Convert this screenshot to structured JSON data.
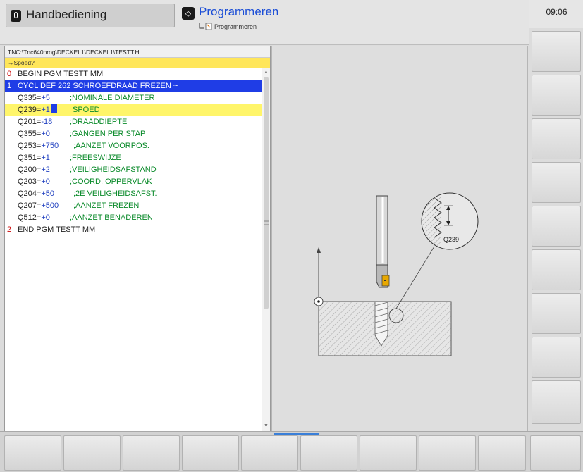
{
  "header": {
    "mode_manual": "Handbediening",
    "mode_program": "Programmeren",
    "mode_program_sub": "Programmeren",
    "clock": "09:06",
    "manual_icon": "hand-icon",
    "program_icon": "diamond-arrow-icon"
  },
  "program": {
    "path": "TNC:\\Tnc640prog\\DECKEL1\\DECKEL1\\TESTT.H",
    "question": "→Spoed?",
    "lines": [
      {
        "num": "0",
        "text": "BEGIN PGM TESTT MM"
      },
      {
        "num": "1",
        "text": "CYCL DEF 262 SCHROEFDRAAD FREZEN ~"
      },
      {
        "q": "Q335=",
        "qv": "+5",
        "comment": ";NOMINALE DIAMETER"
      },
      {
        "q": "Q239=",
        "qv": "+1",
        "comment": "SPOED"
      },
      {
        "q": "Q201=",
        "qv": "-18",
        "comment": ";DRAADDIEPTE"
      },
      {
        "q": "Q355=",
        "qv": "+0",
        "comment": ";GANGEN PER STAP"
      },
      {
        "q": "Q253=",
        "qv": "+750",
        "comment": ";AANZET VOORPOS."
      },
      {
        "q": "Q351=",
        "qv": "+1",
        "comment": ";FREESWIJZE"
      },
      {
        "q": "Q200=",
        "qv": "+2",
        "comment": ";VEILIGHEIDSAFSTAND"
      },
      {
        "q": "Q203=",
        "qv": "+0",
        "comment": ";COORD. OPPERVLAK"
      },
      {
        "q": "Q204=",
        "qv": "+50",
        "comment": ";2E VEILIGHEIDSAFST."
      },
      {
        "q": "Q207=",
        "qv": "+500",
        "comment": ";AANZET FREZEN"
      },
      {
        "q": "Q512=",
        "qv": "+0",
        "comment": ";AANZET BENADEREN"
      },
      {
        "num": "2",
        "text": "END PGM TESTT MM"
      }
    ]
  },
  "graphic": {
    "detail_label": "Q239"
  },
  "colors": {
    "selection": "#1f3de6",
    "active_line": "#fff56a",
    "comment": "#0a8a2a",
    "value": "#2040c0",
    "line_number": "#c00000",
    "question_bar": "#ffe65a"
  }
}
